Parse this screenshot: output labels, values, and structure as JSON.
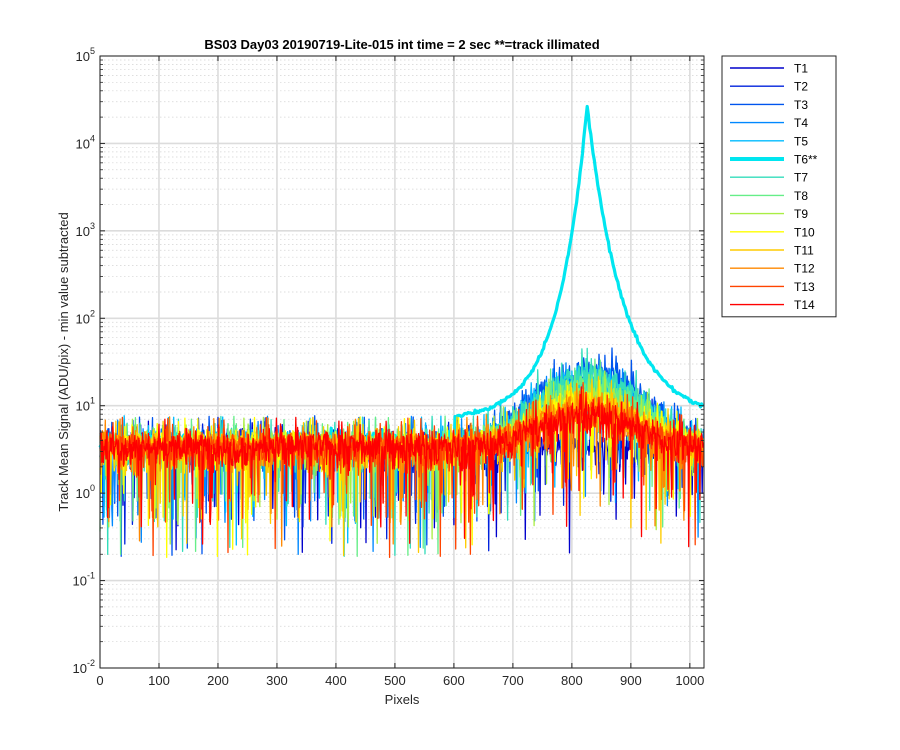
{
  "chart_data": {
    "type": "line",
    "title": "BS03 Day03 20190719-Lite-015 int time = 2 sec    **=track illimated",
    "xlabel": "Pixels",
    "ylabel": "Track Mean Signal (ADU/pix) - min value subtracted",
    "xlim": [
      0,
      1024
    ],
    "ylim": [
      0.01,
      100000
    ],
    "yscale": "log",
    "grid": true,
    "minor_grid": true,
    "legend_position": "outside-right",
    "x_ticks": [
      "0",
      "100",
      "200",
      "300",
      "400",
      "500",
      "600",
      "700",
      "800",
      "900",
      "1000"
    ],
    "x_tick_values": [
      0,
      100,
      200,
      300,
      400,
      500,
      600,
      700,
      800,
      900,
      1000
    ],
    "y_ticks": [
      {
        "base": "10",
        "exp": "-2",
        "value": 0.01
      },
      {
        "base": "10",
        "exp": "-1",
        "value": 0.1
      },
      {
        "base": "10",
        "exp": "0",
        "value": 1
      },
      {
        "base": "10",
        "exp": "1",
        "value": 10
      },
      {
        "base": "10",
        "exp": "2",
        "value": 100
      },
      {
        "base": "10",
        "exp": "3",
        "value": 1000
      },
      {
        "base": "10",
        "exp": "4",
        "value": 10000
      },
      {
        "base": "10",
        "exp": "5",
        "value": 100000
      }
    ],
    "series": [
      {
        "name": "T1",
        "color": "#0000cc",
        "peak": 0,
        "baseline": 3.4,
        "linewidth": 1.4
      },
      {
        "name": "T2",
        "color": "#0022dd",
        "peak": 10,
        "baseline": 3.4,
        "linewidth": 1.4
      },
      {
        "name": "T3",
        "color": "#0055ee",
        "peak": 22,
        "baseline": 3.5,
        "linewidth": 1.4
      },
      {
        "name": "T4",
        "color": "#0088ff",
        "peak": 13,
        "baseline": 3.5,
        "linewidth": 1.4
      },
      {
        "name": "T5",
        "color": "#00bbff",
        "peak": 16,
        "baseline": 3.5,
        "linewidth": 1.4
      },
      {
        "name": "T6**",
        "color": "#00e6f0",
        "peak": 27000,
        "baseline": 3.6,
        "linewidth": 4
      },
      {
        "name": "T7",
        "color": "#33ddbb",
        "peak": 18,
        "baseline": 3.5,
        "linewidth": 1.4
      },
      {
        "name": "T8",
        "color": "#66ee88",
        "peak": 13,
        "baseline": 3.5,
        "linewidth": 1.4
      },
      {
        "name": "T9",
        "color": "#aaee44",
        "peak": 10,
        "baseline": 3.4,
        "linewidth": 1.4
      },
      {
        "name": "T10",
        "color": "#ffff00",
        "peak": 8,
        "baseline": 3.4,
        "linewidth": 1.4
      },
      {
        "name": "T11",
        "color": "#ffcc00",
        "peak": 7,
        "baseline": 3.4,
        "linewidth": 1.4
      },
      {
        "name": "T12",
        "color": "#ff8800",
        "peak": 6,
        "baseline": 3.4,
        "linewidth": 1.4
      },
      {
        "name": "T13",
        "color": "#ff4400",
        "peak": 5,
        "baseline": 3.4,
        "linewidth": 1.4
      },
      {
        "name": "T14",
        "color": "#ff0000",
        "peak": 4.5,
        "baseline": 3.4,
        "linewidth": 1.4
      }
    ],
    "peak_center": 826
  }
}
